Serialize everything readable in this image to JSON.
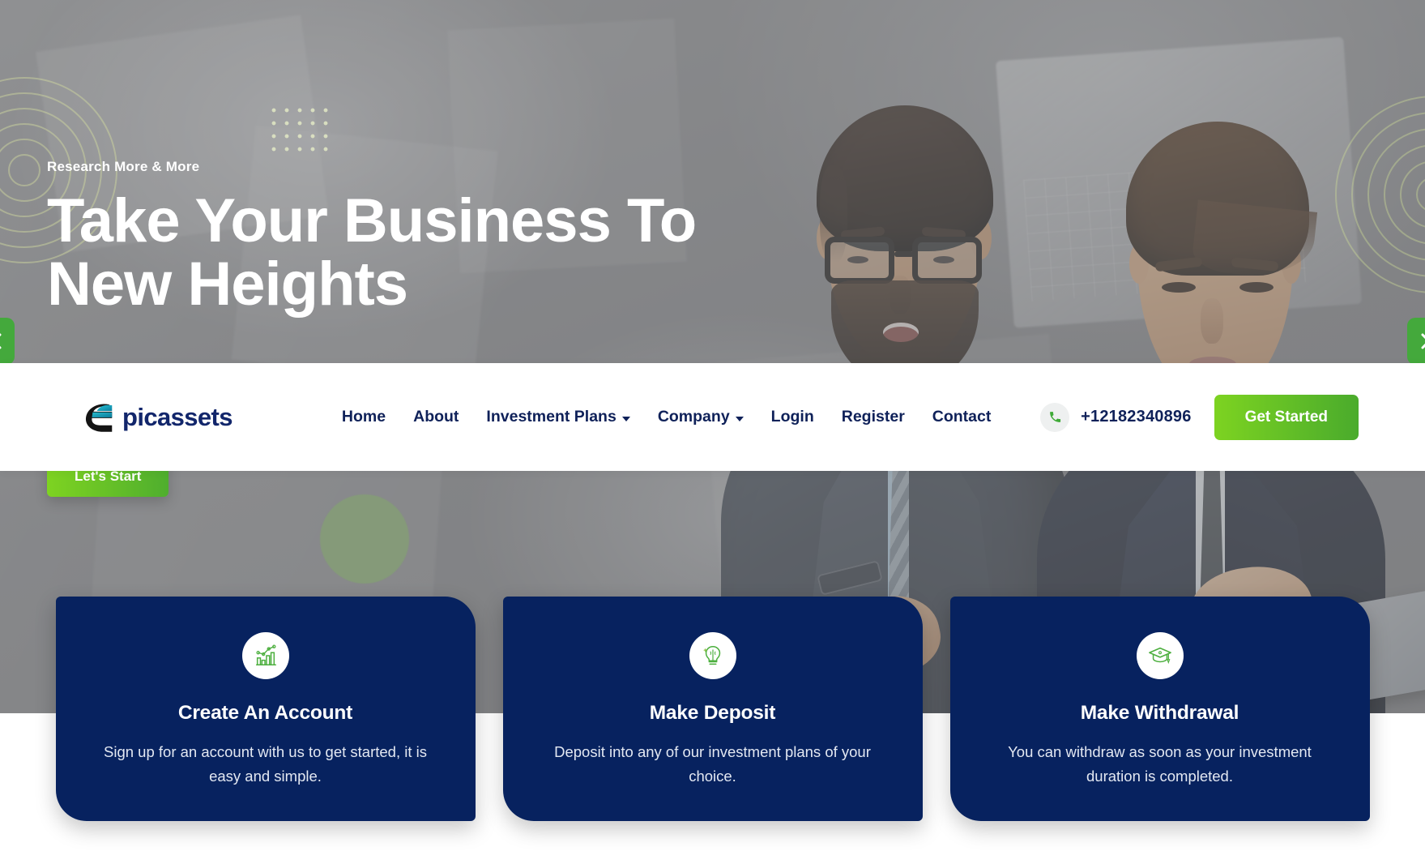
{
  "brand": {
    "name": "picassets",
    "mark": "epicassets-logo-icon"
  },
  "hero": {
    "eyebrow": "Research More & More",
    "title_line1": "Take Your Business To",
    "title_line2": "New Heights",
    "cta_label": "Let's Start",
    "prev_label": "previous-slide",
    "next_label": "next-slide",
    "accent_green": "#4aab2c",
    "overlay_color": "#7d7e81"
  },
  "nav": {
    "items": [
      {
        "label": "Home",
        "has_dropdown": false
      },
      {
        "label": "About",
        "has_dropdown": false
      },
      {
        "label": "Investment Plans",
        "has_dropdown": true
      },
      {
        "label": "Company",
        "has_dropdown": true
      },
      {
        "label": "Login",
        "has_dropdown": false
      },
      {
        "label": "Register",
        "has_dropdown": false
      },
      {
        "label": "Contact",
        "has_dropdown": false
      }
    ],
    "phone": "+12182340896",
    "phone_icon": "phone-icon",
    "cta_label": "Get Started",
    "text_color": "#0f2159"
  },
  "cards": [
    {
      "icon": "growth-chart-icon",
      "title": "Create An Account",
      "desc": "Sign up for an account with us to get started, it is easy and simple."
    },
    {
      "icon": "lightbulb-idea-icon",
      "title": "Make Deposit",
      "desc": "Deposit into any of our investment plans of your choice."
    },
    {
      "icon": "graduation-cap-icon",
      "title": "Make Withdrawal",
      "desc": "You can withdraw as soon as your investment duration is completed."
    }
  ],
  "theme": {
    "card_bg": "#07225f",
    "green": "#4aab2c",
    "navy": "#0f2159"
  }
}
